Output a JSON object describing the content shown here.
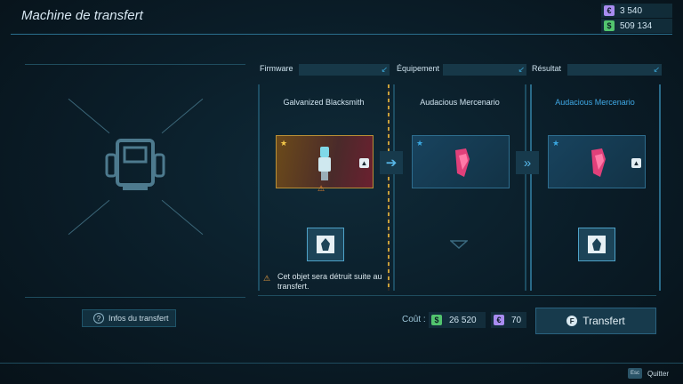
{
  "header": {
    "title": "Machine de transfert"
  },
  "currencies": [
    {
      "icon": "purple-currency-icon",
      "symbol": "€",
      "value": "3 540",
      "color": "#a88cf0"
    },
    {
      "icon": "green-currency-icon",
      "symbol": "$",
      "value": "509 134",
      "color": "#52c46e"
    }
  ],
  "left_panel": {
    "info_button": "Infos du transfert"
  },
  "columns": [
    {
      "header": "Firmware",
      "item": "Galvanized Blacksmith",
      "rarity_color": "#c89a3a"
    },
    {
      "header": "Équipement",
      "item": "Audacious Mercenario",
      "rarity_color": "#2e8fd0"
    },
    {
      "header": "Résultat",
      "item": "Audacious Mercenario",
      "rarity_color": "#2e8fd0"
    }
  ],
  "warning": "Cet objet sera détruit suite au transfert.",
  "cost": {
    "label": "Coût :",
    "money": "26 520",
    "points": "70"
  },
  "transfer_button": {
    "key": "F",
    "label": "Transfert"
  },
  "footer": {
    "esc_key": "Esc",
    "quit_label": "Quitter"
  }
}
